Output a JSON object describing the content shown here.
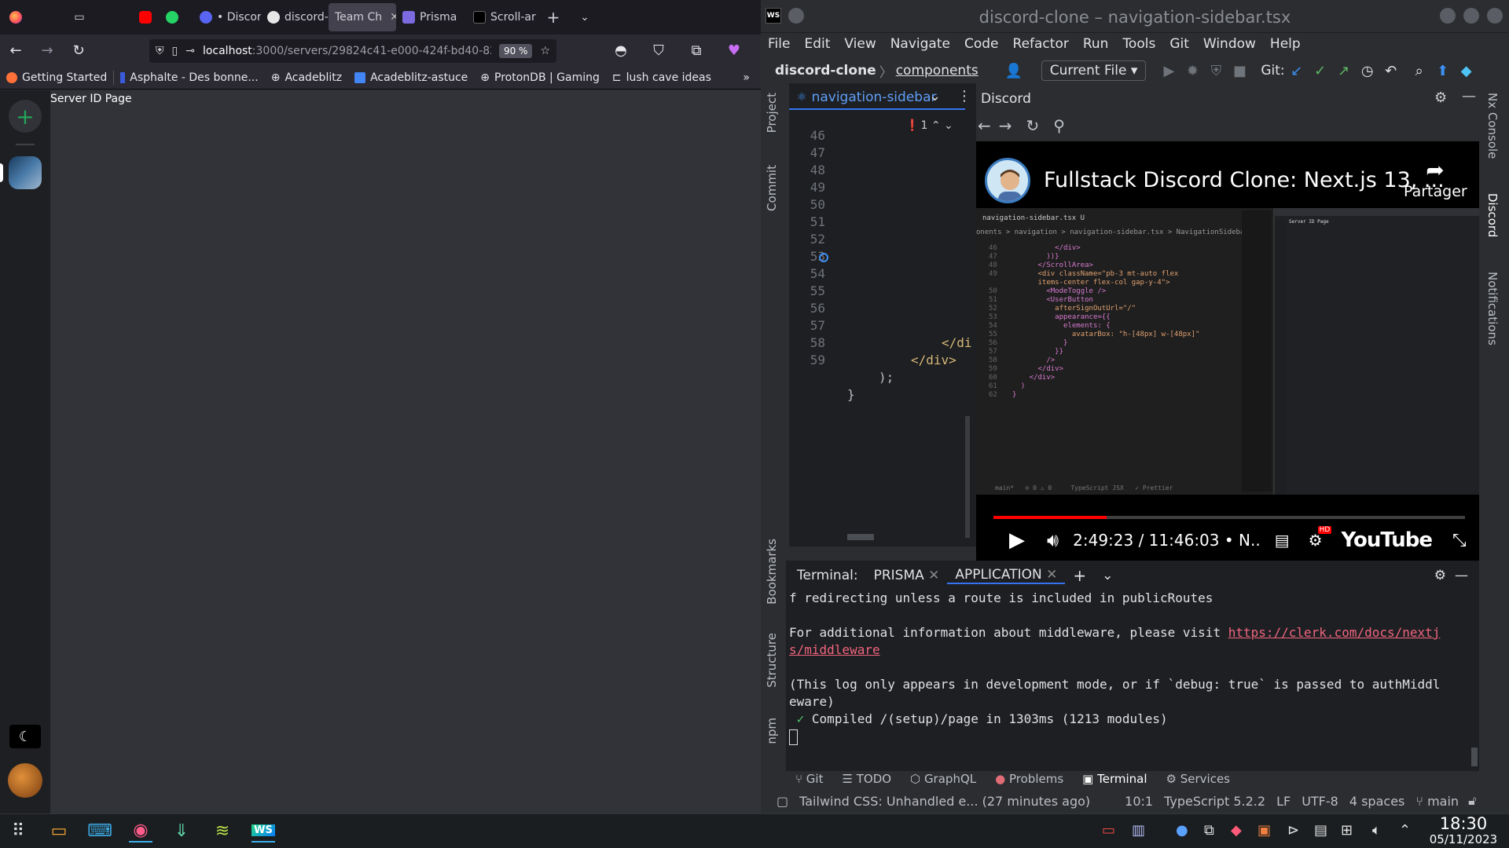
{
  "firefox": {
    "tabs": [
      {
        "label": "",
        "color": "#ff7139"
      },
      {
        "label": "",
        "color": "#8f8f9d"
      },
      {
        "label": "",
        "color": "#ff0000"
      },
      {
        "label": "",
        "color": "#25d366"
      },
      {
        "label": "• Discor",
        "color": "#5865f2"
      },
      {
        "label": "discord-",
        "color": "#ffffff"
      },
      {
        "label": "Team Ch",
        "color": "#000000"
      },
      {
        "label": "Prisma",
        "color": "#5a67d8"
      },
      {
        "label": "Scroll-ar",
        "color": "#000000"
      }
    ],
    "url_host": "localhost",
    "url_rest": ":3000/servers/29824c41-e000-424f-bd40-82",
    "zoom": "90 %",
    "bookmarks": [
      {
        "label": "Getting Started"
      },
      {
        "label": "Asphalte - Des bonne..."
      },
      {
        "label": "Acadeblitz"
      },
      {
        "label": "Acadeblitz-astuce"
      },
      {
        "label": "ProtonDB | Gaming"
      },
      {
        "label": "lush cave ideas"
      }
    ],
    "page_title": "Server ID Page",
    "rail_add": "+"
  },
  "webstorm": {
    "title": "discord-clone – navigation-sidebar.tsx",
    "menu": [
      "File",
      "Edit",
      "View",
      "Navigate",
      "Code",
      "Refactor",
      "Run",
      "Tools",
      "Git",
      "Window",
      "Help"
    ],
    "crumb_project": "discord-clone",
    "crumb_folder": "components",
    "run_config": "Current File",
    "git_label": "Git:",
    "left_tabs": [
      "Project",
      "Commit",
      "Bookmarks",
      "Structure",
      "npm"
    ],
    "right_tabs": [
      "Nx Console",
      "Discord",
      "Notifications"
    ],
    "editor_tab": "navigation-sidebar",
    "error_count": "1",
    "line_numbers": [
      "46",
      "47",
      "48",
      "49",
      "50",
      "51",
      "52",
      "53",
      "54",
      "55",
      "56",
      "57",
      "58",
      "59"
    ],
    "code_div_a": "</di",
    "code_div_b": "</div>",
    "code_close_paren": ");",
    "code_close_brace": "}",
    "discord_panel_title": "Discord",
    "video": {
      "title": "Fullstack Discord Clone: Next.js 13, ...",
      "share": "Partager",
      "time": "2:49:23 / 11:46:03 • N..",
      "progress": 0.24,
      "youtube": "YouTube",
      "hd": "HD",
      "mini_tab": "navigation-sidebar.tsx U",
      "mini_crumb": "onents > navigation > navigation-sidebar.tsx > NavigationSidebar",
      "mini_lines": [
        "46",
        "47",
        "48",
        "49",
        "",
        "50",
        "51",
        "52",
        "53",
        "54",
        "55",
        "56",
        "57",
        "58",
        "59",
        "60",
        "61",
        "62"
      ],
      "mini_code": [
        "          </div>",
        "        ))}",
        "      </ScrollArea>",
        "      <div className=\"pb-3 mt-auto flex",
        "      items-center flex-col gap-y-4\">",
        "        <ModeToggle />",
        "        <UserButton",
        "          afterSignOutUrl=\"/\"",
        "          appearance={{",
        "            elements: {",
        "              avatarBox: \"h-[48px] w-[48px]\"",
        "            }",
        "          }}",
        "        />",
        "      </div>",
        "    </div>",
        "  )",
        "}"
      ],
      "mini_status": "main*   ⊘ 0 ⚠ 0     TypeScript JSX   ✓ Prettier",
      "mini_page": "Server ID Page"
    },
    "terminal": {
      "label": "Terminal:",
      "tabs": [
        "PRISMA",
        "APPLICATION"
      ],
      "line1": "f redirecting unless a route is included in publicRoutes",
      "line2": "For additional information about middleware, please visit ",
      "link1": "https://clerk.com/docs/nextj",
      "link2": "s/middleware",
      "line3": "(This log only appears in development mode, or if `debug: true` is passed to authMiddl",
      "line4": "eware)",
      "line5_check": "✓",
      "line5": " Compiled /(setup)/page in 1303ms (1213 modules)"
    },
    "bottom_tools": [
      "Git",
      "TODO",
      "GraphQL",
      "Problems",
      "Terminal",
      "Services"
    ],
    "status": {
      "message": "Tailwind CSS: Unhandled e... (27 minutes ago)",
      "position": "10:1",
      "lang": "TypeScript 5.2.2",
      "eol": "LF",
      "encoding": "UTF-8",
      "indent": "4 spaces",
      "branch": "main"
    }
  },
  "taskbar": {
    "time": "18:30",
    "date": "05/11/2023"
  }
}
